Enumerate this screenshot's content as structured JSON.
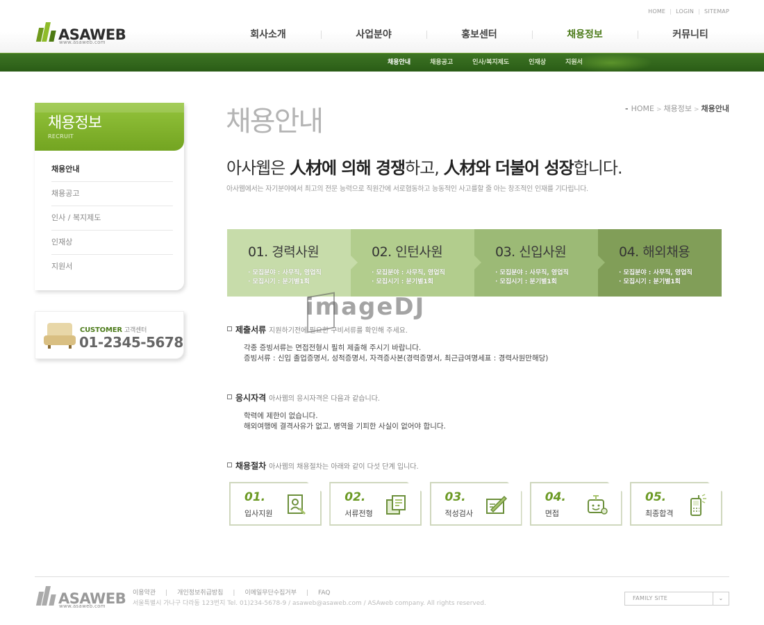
{
  "top_links": [
    "HOME",
    "LOGIN",
    "SITEMAP"
  ],
  "logo": {
    "text": "ASAWEB",
    "url": "www.asaweb.com"
  },
  "gnb": [
    "회사소개",
    "사업분야",
    "홍보센터",
    "채용정보",
    "커뮤니티"
  ],
  "subnav": [
    "채용안내",
    "채용공고",
    "인사/복지제도",
    "인재상",
    "지원서"
  ],
  "sidebar": {
    "title": "채용정보",
    "subtitle": "RECRUIT",
    "items": [
      "채용안내",
      "채용공고",
      "인사 / 복지제도",
      "인재상",
      "지원서"
    ]
  },
  "customer": {
    "label": "CUSTOMER",
    "label_kr": "고객센터",
    "phone": "01-2345-5678"
  },
  "page_title": "채용안내",
  "breadcrumb": {
    "home": "HOME",
    "parent": "채용정보",
    "current": "채용안내"
  },
  "headline": {
    "p1": "아사웹은 ",
    "b1": "人材에 의해 경쟁",
    "p2": "하고, ",
    "b2": "人材와 더불어 성장",
    "p3": "합니다."
  },
  "subline": "아사웹에서는 자기분야에서 최고의 전문 능력으로 직원간에 서로협동하고 능동적인 사고를할 줄 아는 창조적인 인재를 기다립니다.",
  "types": [
    {
      "num": "01.",
      "title": "경력사원",
      "line1": "· 모집분야 : 사무직, 영업직",
      "line2": "· 모집시기 : 분기별1회"
    },
    {
      "num": "02.",
      "title": "인턴사원",
      "line1": "· 모집분야 : 사무직, 영업직",
      "line2": "· 모집시기 : 분기별1회"
    },
    {
      "num": "03.",
      "title": "신입사원",
      "line1": "· 모집분야 : 사무직, 영업직",
      "line2": "· 모집시기 : 분기별1회"
    },
    {
      "num": "04.",
      "title": "해외채용",
      "line1": "· 모집분야 : 사무직, 영업직",
      "line2": "· 모집시기 : 분기별1회"
    }
  ],
  "watermark": "imageDJ",
  "sections": {
    "docs": {
      "title": "제출서류",
      "desc": "지원하기전에 필요한 구비서류를 확인해 주세요.",
      "line1": "각종 증빙서류는 면접전형시 필히 제출해 주시기 바랍니다.",
      "line2": "증빙서류 : 신입 졸업증명서, 성적증명서, 자격증사본(경력증명서, 최근급여명세표 : 경력사원만해당)"
    },
    "qual": {
      "title": "응시자격",
      "desc": "아사웹의 응시자격은 다음과 같습니다.",
      "line1": "학력에 제한이 없습니다.",
      "line2": "해외여행에 결격사유가 없고, 병역을 기피한 사실이 없어야 합니다."
    },
    "proc": {
      "title": "채용절차",
      "desc": "아사웹의 채용절차는 아래와 같이 다섯 단계 입니다."
    }
  },
  "steps": [
    {
      "num": "01.",
      "label": "입사지원",
      "icon": "application-form-icon"
    },
    {
      "num": "02.",
      "label": "서류전형",
      "icon": "documents-icon"
    },
    {
      "num": "03.",
      "label": "적성검사",
      "icon": "pencil-test-icon"
    },
    {
      "num": "04.",
      "label": "면접",
      "icon": "interview-icon"
    },
    {
      "num": "05.",
      "label": "최종합격",
      "icon": "phone-notify-icon"
    }
  ],
  "footer": {
    "links": [
      "이용약관",
      "개인정보취급방침",
      "이메일무단수집거부",
      "FAQ"
    ],
    "address": "서울특별시 가나구 다라동 123번지    Tel. 01)234-5678-9 / asaweb@asaweb.com / ASAweb company. All rights reserved.",
    "family_site": "FAMILY SITE"
  },
  "colors": {
    "brand_green": "#4c7b1a",
    "bar_green": "#2f6119",
    "accent_light": "#94c43c"
  }
}
